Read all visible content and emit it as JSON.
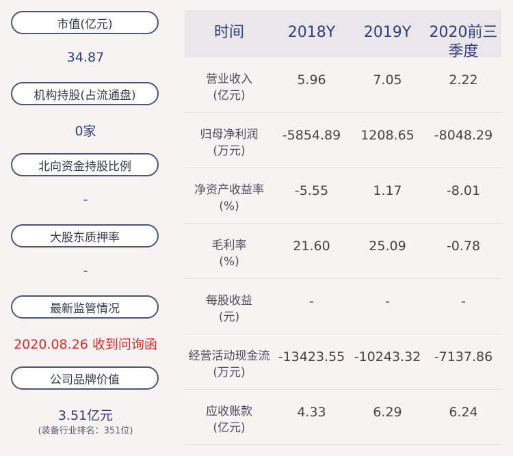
{
  "left": {
    "items": [
      {
        "label": "市值(亿元)",
        "value": "34.87"
      },
      {
        "label": "机构持股(占流通盘)",
        "value": "0家"
      },
      {
        "label": "北向资金持股比例",
        "value": "-"
      },
      {
        "label": "大股东质押率",
        "value": "-"
      },
      {
        "label": "最新监管情况",
        "value": "2020.08.26 收到问询函"
      },
      {
        "label": "公司品牌价值",
        "value": "3.51亿元",
        "note": "(装备行业排名：351位)"
      }
    ]
  },
  "table": {
    "headers": [
      "时间",
      "2018Y",
      "2019Y",
      "2020前三\n季度"
    ],
    "rows": [
      {
        "label": [
          "营业收入",
          "(亿元)"
        ],
        "values": [
          "5.96",
          "7.05",
          "2.22"
        ]
      },
      {
        "label": [
          "归母净利润",
          "(万元)"
        ],
        "values": [
          "-5854.89",
          "1208.65",
          "-8048.29"
        ]
      },
      {
        "label": [
          "净资产收益率",
          "(%)"
        ],
        "values": [
          "-5.55",
          "1.17",
          "-8.01"
        ]
      },
      {
        "label": [
          "毛利率",
          "(%)"
        ],
        "values": [
          "21.60",
          "25.09",
          "-0.78"
        ]
      },
      {
        "label": [
          "每股收益",
          "(元)"
        ],
        "values": [
          "-",
          "-",
          "-"
        ]
      },
      {
        "label": [
          "经营活动现金流",
          "(万元)"
        ],
        "values": [
          "-13423.55",
          "-10243.32",
          "-7137.86"
        ]
      },
      {
        "label": [
          "应收账款",
          "(亿元)"
        ],
        "values": [
          "4.33",
          "6.29",
          "6.24"
        ]
      }
    ]
  },
  "colors": {
    "accent": "#2f3c7a",
    "alert": "#d62b2b",
    "header_bg": "#e9e7ea"
  }
}
